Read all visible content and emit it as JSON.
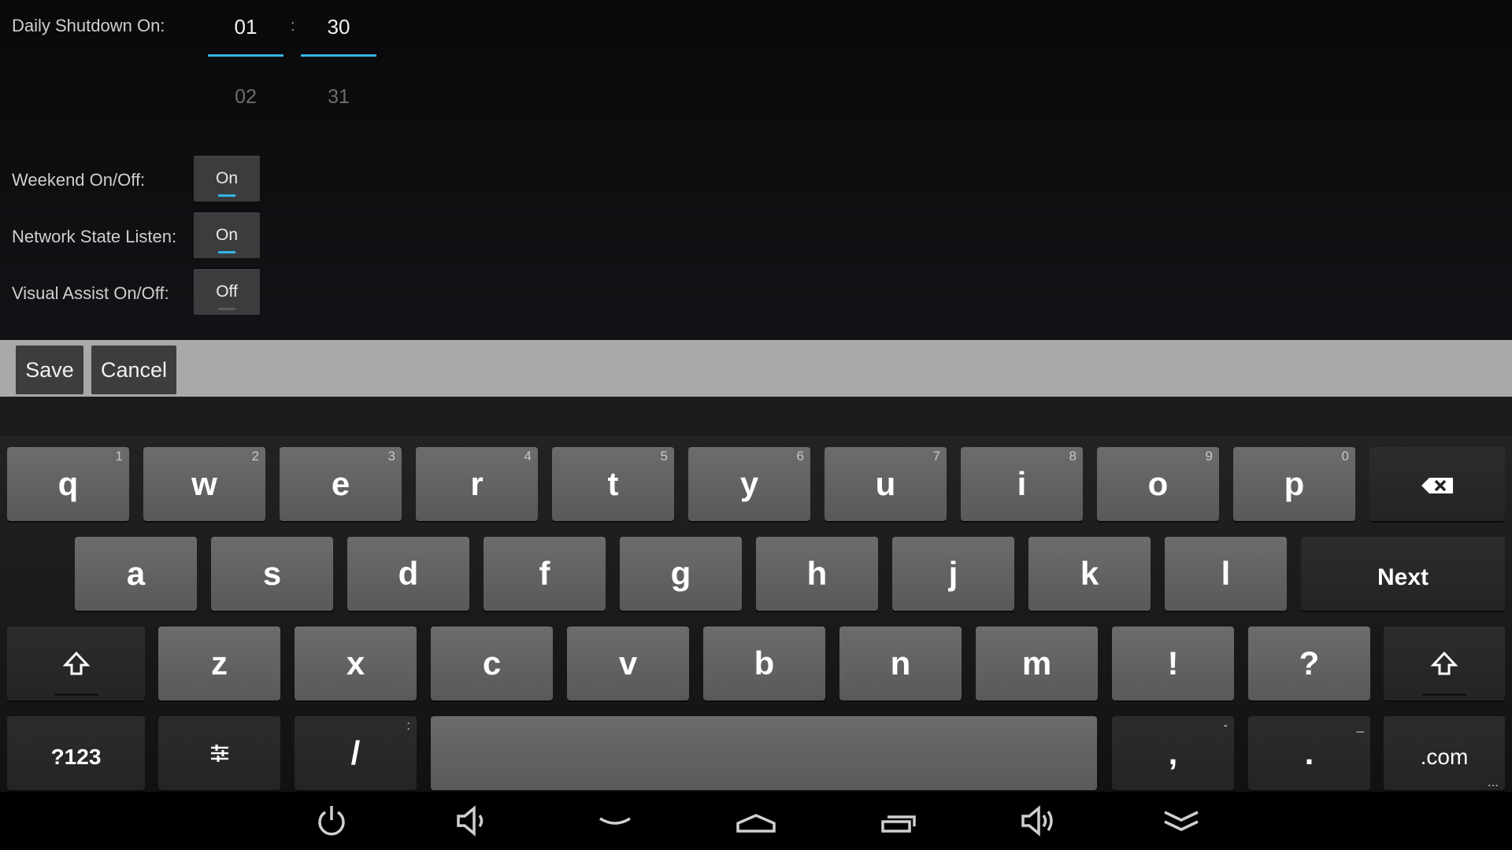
{
  "settings": {
    "shutdown_label": "Daily Shutdown On:",
    "hour_value": "01",
    "minute_value": "30",
    "colon": ":",
    "hour_next": "02",
    "minute_next": "31",
    "weekend_label": "Weekend On/Off:",
    "weekend_value": "On",
    "network_label": "Network State Listen:",
    "network_value": "On",
    "visual_label": "Visual Assist On/Off:",
    "visual_value": "Off"
  },
  "actions": {
    "save": "Save",
    "cancel": "Cancel"
  },
  "keyboard": {
    "row1": [
      {
        "label": "q",
        "hint": "1"
      },
      {
        "label": "w",
        "hint": "2"
      },
      {
        "label": "e",
        "hint": "3"
      },
      {
        "label": "r",
        "hint": "4"
      },
      {
        "label": "t",
        "hint": "5"
      },
      {
        "label": "y",
        "hint": "6"
      },
      {
        "label": "u",
        "hint": "7"
      },
      {
        "label": "i",
        "hint": "8"
      },
      {
        "label": "o",
        "hint": "9"
      },
      {
        "label": "p",
        "hint": "0"
      }
    ],
    "row2": [
      "a",
      "s",
      "d",
      "f",
      "g",
      "h",
      "j",
      "k",
      "l"
    ],
    "next_label": "Next",
    "row3": [
      "z",
      "x",
      "c",
      "v",
      "b",
      "n",
      "m",
      "!",
      "?"
    ],
    "symbols_label": "?123",
    "slash_label": "/",
    "slash_hint": ":",
    "comma_label": ",",
    "comma_hint": "-",
    "period_label": ".",
    "period_hint": "_",
    "dotcom_label": ".com",
    "dotcom_hint": "..."
  },
  "colors": {
    "accent": "#33b5e5",
    "action_bar": "#a9a9a9",
    "key": "#606163"
  },
  "icons": [
    "backspace-icon",
    "shift-icon",
    "settings-sliders-icon",
    "power-icon",
    "volume-down-icon",
    "back-icon",
    "home-icon",
    "recent-apps-icon",
    "volume-up-icon",
    "hide-keyboard-icon"
  ]
}
